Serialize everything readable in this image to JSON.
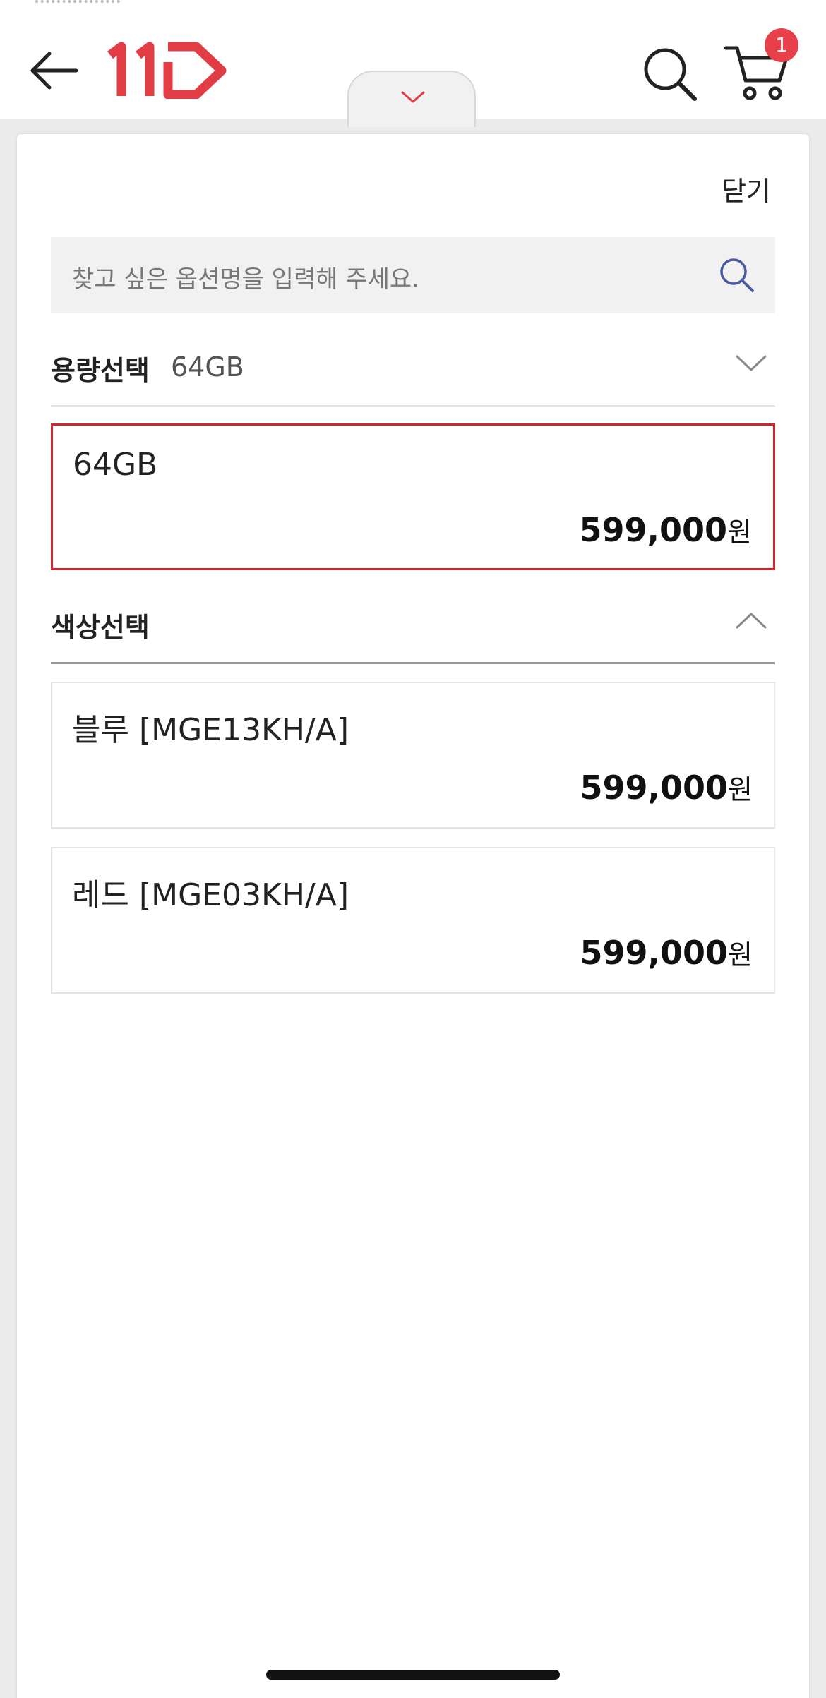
{
  "header": {
    "logo_text": "11",
    "cart_count": "1",
    "icons": [
      "back-arrow-icon",
      "logo-11st",
      "search-icon",
      "cart-icon"
    ],
    "accent_color": "#e8404a"
  },
  "sheet": {
    "close_label": "닫기",
    "search": {
      "placeholder": "찾고 싶은 옵션명을 입력해 주세요."
    },
    "capacity": {
      "title": "용량선택",
      "selected_value": "64GB",
      "options": [
        {
          "name": "64GB",
          "price": "599,000",
          "unit": "원",
          "selected": true
        }
      ]
    },
    "color": {
      "title": "색상선택",
      "options": [
        {
          "name": "블루 [MGE13KH/A]",
          "price": "599,000",
          "unit": "원"
        },
        {
          "name": "레드 [MGE03KH/A]",
          "price": "599,000",
          "unit": "원"
        }
      ]
    }
  }
}
